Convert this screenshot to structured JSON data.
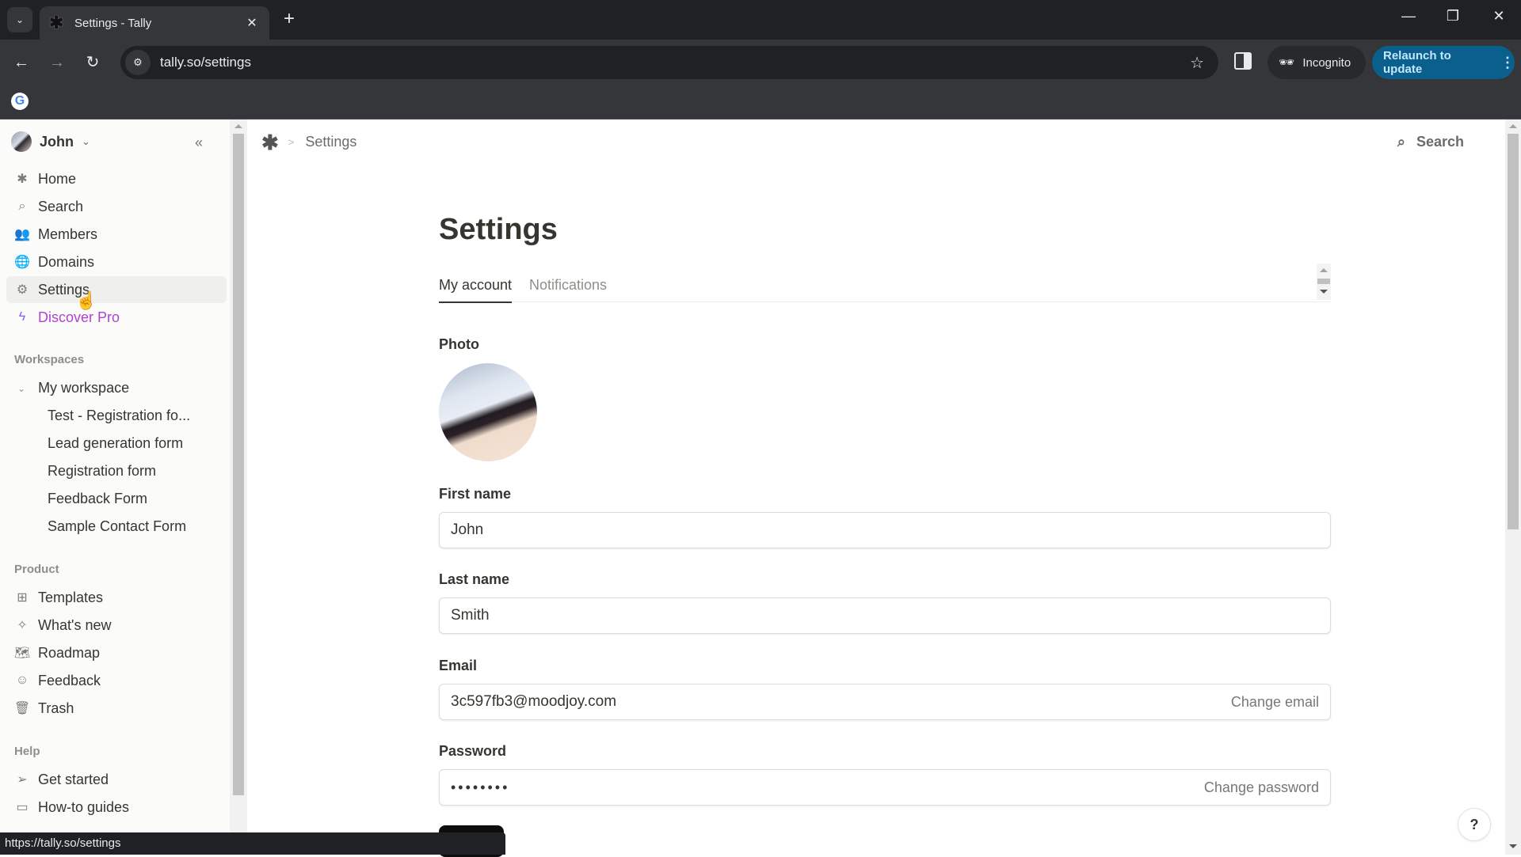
{
  "browser": {
    "tab_title": "Settings - Tally",
    "tab_favicon": "tally-asterisk-icon",
    "url": "tally.so/settings",
    "incognito_label": "Incognito",
    "relaunch_label": "Relaunch to update",
    "status_url": "https://tally.so/settings",
    "bookmark_icon": "google-icon",
    "icons": {
      "tab_list": "⌄",
      "close": "✕",
      "new_tab": "+",
      "minimize": "—",
      "restore": "❐",
      "window_close": "✕",
      "back": "←",
      "forward": "→",
      "reload": "↻",
      "site_info": "⚙",
      "star": "☆",
      "incognito": "🕶",
      "menu": "⋮",
      "google": "G"
    }
  },
  "sidebar": {
    "workspace_user": "John",
    "collapse_icon": "«",
    "chevron": "⌄",
    "nav": [
      {
        "label": "Home",
        "icon": "✱"
      },
      {
        "label": "Search",
        "icon": "⌕"
      },
      {
        "label": "Members",
        "icon": "👥"
      },
      {
        "label": "Domains",
        "icon": "🌐"
      },
      {
        "label": "Settings",
        "icon": "⚙",
        "active": true
      },
      {
        "label": "Discover Pro",
        "icon": "ϟ"
      }
    ],
    "workspaces_label": "Workspaces",
    "workspace": {
      "name": "My workspace",
      "expand_icon": "⌄",
      "forms": [
        "Test - Registration fo...",
        "Lead generation form",
        "Registration form",
        "Feedback Form",
        "Sample Contact Form"
      ]
    },
    "product_label": "Product",
    "product": [
      {
        "label": "Templates",
        "icon": "⊞"
      },
      {
        "label": "What's new",
        "icon": "✧"
      },
      {
        "label": "Roadmap",
        "icon": "🗺"
      },
      {
        "label": "Feedback",
        "icon": "☺"
      },
      {
        "label": "Trash",
        "icon": "🗑"
      }
    ],
    "help_label": "Help",
    "help": [
      {
        "label": "Get started",
        "icon": "➢"
      },
      {
        "label": "How-to guides",
        "icon": "▭"
      }
    ]
  },
  "main": {
    "breadcrumb": {
      "logo": "✱",
      "separator": ">",
      "current": "Settings"
    },
    "search_label": "Search",
    "search_icon": "⌕",
    "title": "Settings",
    "tabs": [
      {
        "label": "My account",
        "active": true
      },
      {
        "label": "Notifications",
        "active": false
      }
    ],
    "photo_label": "Photo",
    "first_name_label": "First name",
    "first_name": "John",
    "last_name_label": "Last name",
    "last_name": "Smith",
    "email_label": "Email",
    "email": "3c597fb3@moodjoy.com",
    "change_email": "Change email",
    "password_label": "Password",
    "password": "••••••••",
    "change_password": "Change password",
    "help_button": "?"
  },
  "colors": {
    "accent_pro": "#b043cf",
    "relaunch_bg": "#0b5f8c",
    "relaunch_text": "#c2e7ff",
    "text": "#37352f",
    "muted": "#8f8e8a"
  }
}
